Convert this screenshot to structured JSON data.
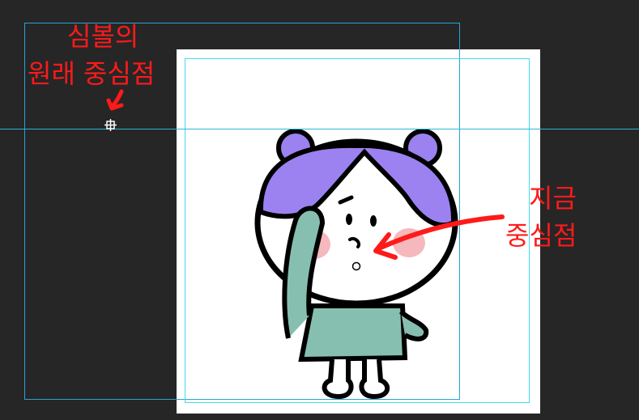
{
  "annotations": {
    "original_center_line1": "심볼의",
    "original_center_line2": "원래 중심점",
    "current_center_line1": "지금",
    "current_center_line2": "중심점"
  },
  "colors": {
    "annotation": "#ff1a1a",
    "background": "#262626",
    "guide": "#2fb6d3",
    "hair": "#9b82f0",
    "dress": "#86bfb0",
    "blush": "#f5b8bc"
  },
  "icons": {
    "original_center_marker": "registration-point-icon",
    "current_center_marker": "transform-center-icon"
  }
}
